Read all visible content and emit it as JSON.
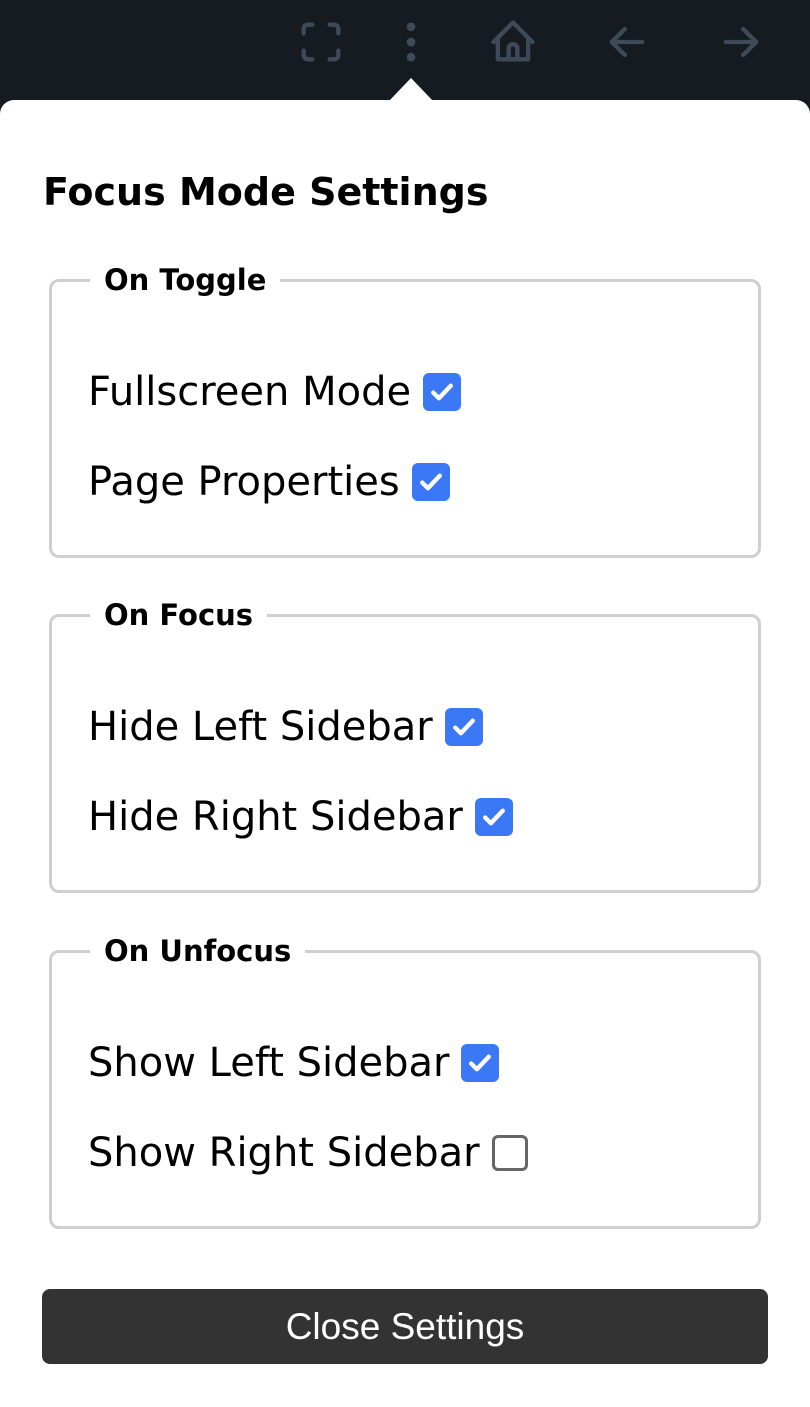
{
  "toolbar": {
    "icons": [
      "fullscreen-icon",
      "more-vertical-icon",
      "home-icon",
      "arrow-left-icon",
      "arrow-right-icon"
    ],
    "icon_color": "#3e4a57"
  },
  "panel": {
    "title": "Focus Mode Settings",
    "groups": [
      {
        "legend": "On Toggle",
        "options": [
          {
            "label": "Fullscreen Mode",
            "checked": true
          },
          {
            "label": "Page Properties",
            "checked": true
          }
        ]
      },
      {
        "legend": "On Focus",
        "options": [
          {
            "label": "Hide Left Sidebar",
            "checked": true
          },
          {
            "label": "Hide Right Sidebar",
            "checked": true
          }
        ]
      },
      {
        "legend": "On Unfocus",
        "options": [
          {
            "label": "Show Left Sidebar",
            "checked": true
          },
          {
            "label": "Show Right Sidebar",
            "checked": false
          }
        ]
      }
    ],
    "close_label": "Close Settings",
    "accent": "#3b78f6"
  }
}
